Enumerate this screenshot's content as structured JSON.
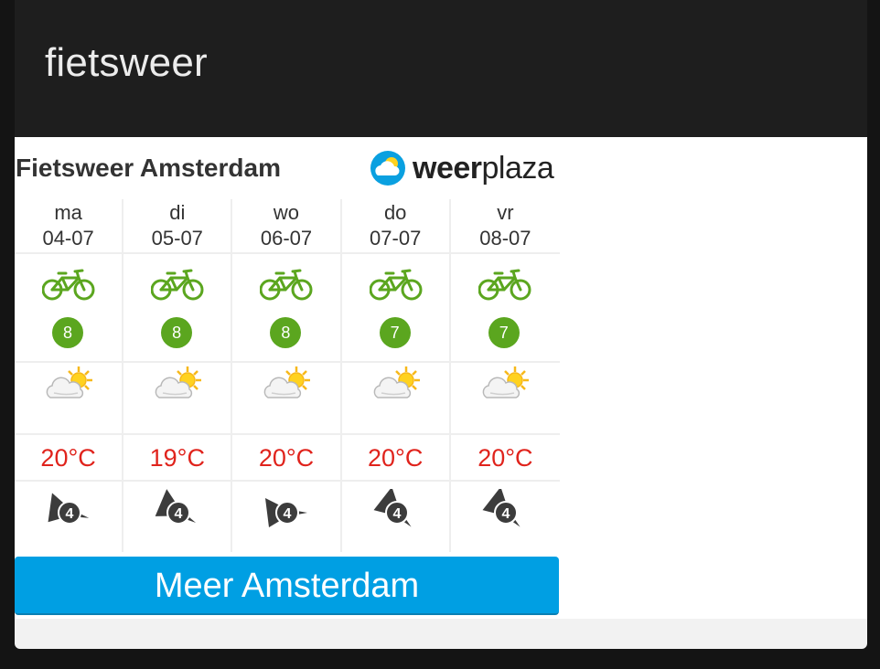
{
  "card": {
    "title": "fietsweer"
  },
  "widget": {
    "title": "Fietsweer Amsterdam",
    "brand": {
      "bold": "weer",
      "light": "plaza"
    },
    "days": [
      {
        "day": "ma",
        "date": "04-07",
        "score": "8",
        "temp": "20°C",
        "weather_icon": "sun-cloud-icon",
        "wind_bft": "4",
        "wind_dir_deg": 15
      },
      {
        "day": "di",
        "date": "05-07",
        "score": "8",
        "temp": "19°C",
        "weather_icon": "sun-cloud-icon",
        "wind_bft": "4",
        "wind_dir_deg": 30
      },
      {
        "day": "wo",
        "date": "06-07",
        "score": "8",
        "temp": "20°C",
        "weather_icon": "sun-cloud-icon",
        "wind_bft": "4",
        "wind_dir_deg": 0
      },
      {
        "day": "do",
        "date": "07-07",
        "score": "7",
        "temp": "20°C",
        "weather_icon": "sun-cloud-icon",
        "wind_bft": "4",
        "wind_dir_deg": 45
      },
      {
        "day": "vr",
        "date": "08-07",
        "score": "7",
        "temp": "20°C",
        "weather_icon": "sun-cloud-icon",
        "wind_bft": "4",
        "wind_dir_deg": 45
      }
    ],
    "more_button": "Meer Amsterdam"
  },
  "colors": {
    "header_bg": "#1e1e1e",
    "bike_green": "#5ba61f",
    "temp_red": "#e0231c",
    "button_blue": "#009fe3"
  }
}
